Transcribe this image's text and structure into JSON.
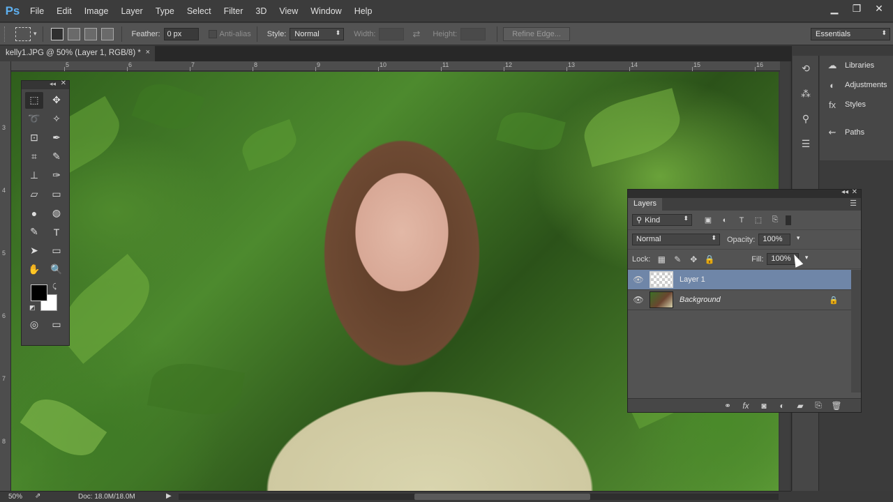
{
  "app": {
    "logo": "Ps"
  },
  "menu": [
    "File",
    "Edit",
    "Image",
    "Layer",
    "Type",
    "Select",
    "Filter",
    "3D",
    "View",
    "Window",
    "Help"
  ],
  "window_controls": {
    "minimize": "▁",
    "restore": "❐",
    "close": "✕"
  },
  "options": {
    "feather_label": "Feather:",
    "feather_value": "0 px",
    "antialias_label": "Anti-alias",
    "style_label": "Style:",
    "style_value": "Normal",
    "width_label": "Width:",
    "height_label": "Height:",
    "refine_edge": "Refine Edge...",
    "workspace": "Essentials"
  },
  "document": {
    "tab_title": "kelly1.JPG @ 50% (Layer 1, RGB/8) *",
    "close": "×"
  },
  "rulers": {
    "top": [
      "5",
      "6",
      "7",
      "8",
      "9",
      "10",
      "11",
      "12",
      "13",
      "14",
      "15",
      "16"
    ],
    "left": [
      "3",
      "4",
      "5",
      "6",
      "7",
      "8"
    ]
  },
  "toolbox": {
    "rows": [
      [
        "marquee-tool-icon",
        "move-tool-icon"
      ],
      [
        "lasso-tool-icon",
        "magic-wand-tool-icon"
      ],
      [
        "crop-tool-icon",
        "eyedropper-tool-icon"
      ],
      [
        "spot-healing-tool-icon",
        "brush-tool-icon"
      ],
      [
        "clone-stamp-tool-icon",
        "history-brush-tool-icon"
      ],
      [
        "eraser-tool-icon",
        "gradient-tool-icon"
      ],
      [
        "blur-tool-icon",
        "dodge-tool-icon"
      ],
      [
        "pen-tool-icon",
        "type-tool-icon"
      ],
      [
        "path-selection-tool-icon",
        "shape-tool-icon"
      ],
      [
        "hand-tool-icon",
        "zoom-tool-icon"
      ]
    ],
    "glyphs": [
      "⬚",
      "✥",
      "➰",
      "✧",
      "⊡",
      "✒",
      "⌗",
      "✎",
      "⊥",
      "✑",
      "▱",
      "▭",
      "●",
      "◍",
      "✎",
      "T",
      "➤",
      "▭",
      "✋",
      "🔍"
    ],
    "foreground_color": "#000000",
    "background_color": "#ffffff"
  },
  "side_panels": [
    {
      "label": "Libraries",
      "icon": "libraries-icon",
      "glyph": "☁"
    },
    {
      "label": "Adjustments",
      "icon": "adjustments-icon",
      "glyph": "◐"
    },
    {
      "label": "Styles",
      "icon": "styles-icon",
      "glyph": "fx"
    },
    {
      "label": "Paths",
      "icon": "paths-icon",
      "glyph": "⇜"
    }
  ],
  "layers_panel": {
    "title": "Layers",
    "filter_kind": "Kind",
    "blend_mode": "Normal",
    "opacity_label": "Opacity:",
    "opacity_value": "100%",
    "lock_label": "Lock:",
    "fill_label": "Fill:",
    "fill_value": "100%",
    "layers": [
      {
        "name": "Layer 1",
        "selected": true,
        "thumb": "transparent"
      },
      {
        "name": "Background",
        "selected": false,
        "thumb": "photo",
        "locked": true
      }
    ]
  },
  "status": {
    "zoom": "50%",
    "doc": "Doc: 18.0M/18.0M"
  }
}
